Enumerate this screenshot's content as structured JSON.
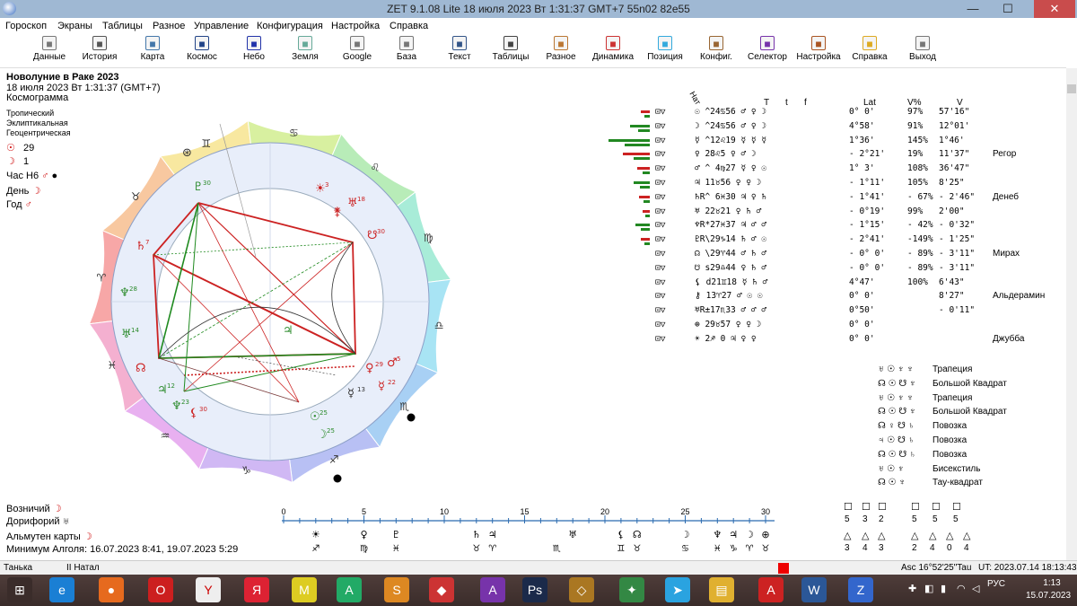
{
  "window": {
    "title": "ZET 9.1.08 Lite    18 июля 2023   Вт    1:31:37 GMT+7 55n02  82e55"
  },
  "menu": [
    "Гороскоп",
    "Экраны",
    "Таблицы",
    "Разное",
    "Управление",
    "Конфигурация",
    "Настройка",
    "Справка"
  ],
  "toolbar": [
    "Данные",
    "История",
    "Карта",
    "Космос",
    "Небо",
    "Земля",
    "Google",
    "База",
    "Текст",
    "Таблицы",
    "Разное",
    "Динамика",
    "Позиция",
    "Конфиг.",
    "Селектор",
    "Настройка",
    "Справка",
    "Выход"
  ],
  "toolbar_icons": [
    "data-icon",
    "history-icon",
    "map-icon",
    "cosmos-icon",
    "sky-icon",
    "earth-icon",
    "google-icon",
    "database-icon",
    "text-icon",
    "tables-icon",
    "misc-icon",
    "dynamics-icon",
    "position-icon",
    "config-icon",
    "selector-icon",
    "settings-icon",
    "help-icon",
    "exit-icon"
  ],
  "chart_info": {
    "title": "Новолуние в Раке 2023",
    "datetime": "18 июля 2023   Вт    1:31:37 (GMT+7)",
    "kind": "Космограмма",
    "system1": "Тропический",
    "system2": "Эклиптикальная",
    "system3": "Геоцентрическая",
    "sun_num": "29",
    "moon_num": "1",
    "hour_label": "Час Н6",
    "day_label": "День",
    "year_label": "Год"
  },
  "houses_label": "Нат",
  "table_header": {
    "T": "T",
    "t": "t",
    "f": "f",
    "lat": "Lat",
    "vpct": "V%",
    "v": "V"
  },
  "table_rows": [
    {
      "main": "☉ ^24♋56  ♂ ♀ ☽",
      "lat": "0° 0'",
      "vp": "97%",
      "v": "57'16\"",
      "star": ""
    },
    {
      "main": "☽ ^24♋56  ♂ ♀ ☽",
      "lat": "4°58'",
      "vp": "91%",
      "v": "12°01'",
      "star": ""
    },
    {
      "main": "☿ ^12♌19  ☿ ☿ ☿",
      "lat": "1°36'",
      "vp": "145%",
      "v": "1°46'",
      "star": ""
    },
    {
      "main": "♀  28♌5  ♀ ♂ ☽",
      "lat": "- 2°21'",
      "vp": "19%",
      "v": "11'37\"",
      "star": "Регор"
    },
    {
      "main": "♂ ^ 4♍27  ☿ ♀ ☉",
      "lat": "1° 3'",
      "vp": "108%",
      "v": "36'47\"",
      "star": ""
    },
    {
      "main": "♃  11♉56  ♀ ♀ ☽",
      "lat": "- 1°11'",
      "vp": "105%",
      "v": "8'25\"",
      "star": ""
    },
    {
      "main": "♄R^ 6♓30  ♃ ♀ ♄",
      "lat": "- 1°41'",
      "vp": "- 67%",
      "v": "- 2'46\"",
      "star": "Денеб"
    },
    {
      "main": "♅  22♉21  ♀ ♄ ♂",
      "lat": "- 0°19'",
      "vp": "99%",
      "v": "2'00\"",
      "star": ""
    },
    {
      "main": "♆R*27♓37  ♃ ♂ ♂",
      "lat": "- 1°15'",
      "vp": "- 42%",
      "v": "- 0'32\"",
      "star": ""
    },
    {
      "main": "♇R\\29♑14  ♄ ♂ ☉",
      "lat": "- 2°41'",
      "vp": "-149%",
      "v": "- 1'25\"",
      "star": ""
    },
    {
      "main": "☊ \\29♈44  ♂ ♄ ♂",
      "lat": "- 0° 0'",
      "vp": "- 89%",
      "v": "- 3'11\"",
      "star": "Мирах"
    },
    {
      "main": "☋ s29♎44  ♀ ♄ ♂",
      "lat": "- 0° 0'",
      "vp": "- 89%",
      "v": "- 3'11\"",
      "star": ""
    },
    {
      "main": "⚸ d21♊18  ☿ ♄ ♂",
      "lat": "4°47'",
      "vp": "100%",
      "v": "6'43\"",
      "star": ""
    },
    {
      "main": "⚷  13♈27  ♂ ☉ ☉",
      "lat": "0° 0'",
      "vp": "",
      "v": "8'27\"",
      "star": "Альдерамин"
    },
    {
      "main": "♅R±17♏33  ♂ ♂ ♂",
      "lat": "0°50'",
      "vp": "",
      "v": "- 0'11\"",
      "star": ""
    },
    {
      "main": "⊕  29♉57  ♀ ♀ ☽",
      "lat": "0° 0'",
      "vp": "",
      "v": "",
      "star": ""
    },
    {
      "main": "☀  2♐ 0  ♃ ♀ ♀",
      "lat": "0° 0'",
      "vp": "",
      "v": "",
      "star": "Джубба"
    }
  ],
  "configurations": [
    {
      "symbols": "♅ ☉ ♆ ♆",
      "name": "Трапеция"
    },
    {
      "symbols": "☊ ☉ ☋ ♆",
      "name": "Большой Квадрат"
    },
    {
      "symbols": "♅ ☉ ♆ ♆",
      "name": "Трапеция"
    },
    {
      "symbols": "☊ ☉ ☋ ♆",
      "name": "Большой Квадрат"
    },
    {
      "symbols": "☊ ♀ ☋ ♄",
      "name": "Повозка"
    },
    {
      "symbols": "♃ ☉ ☋ ♄",
      "name": "Повозка"
    },
    {
      "symbols": "☊ ☉ ☋ ♄",
      "name": "Повозка"
    },
    {
      "symbols": "♅ ☉ ♆",
      "name": "Бисекстиль"
    },
    {
      "symbols": "☊ ☉ ♆",
      "name": "Тау-квадрат"
    }
  ],
  "bottom_left": {
    "vozn": "Возничий",
    "dorif": "Дорифорий",
    "almuten": "Альмутен карты",
    "algol": "Минимум Алголя: 16.07.2023  8:41,  19.07.2023  5:29"
  },
  "scale_labels": [
    "0",
    "5",
    "10",
    "15",
    "20",
    "25",
    "30"
  ],
  "counts_top": [
    "5",
    "3",
    "2",
    "5",
    "5",
    "5"
  ],
  "counts_bottom": [
    "3",
    "4",
    "3",
    "2",
    "4",
    "0",
    "4"
  ],
  "status": {
    "left": "Танька",
    "mid": "II Натал",
    "asc": "Asc  16°52'25\"Tau",
    "ut": "UT: 2023.07.14 18:13:43"
  },
  "tray": {
    "lang": "РУС",
    "time": "1:13",
    "date": "15.07.2023"
  },
  "colors": {
    "accent_red": "#cc2222",
    "accent_green": "#228822",
    "titlebar": "#9fb8d3"
  }
}
